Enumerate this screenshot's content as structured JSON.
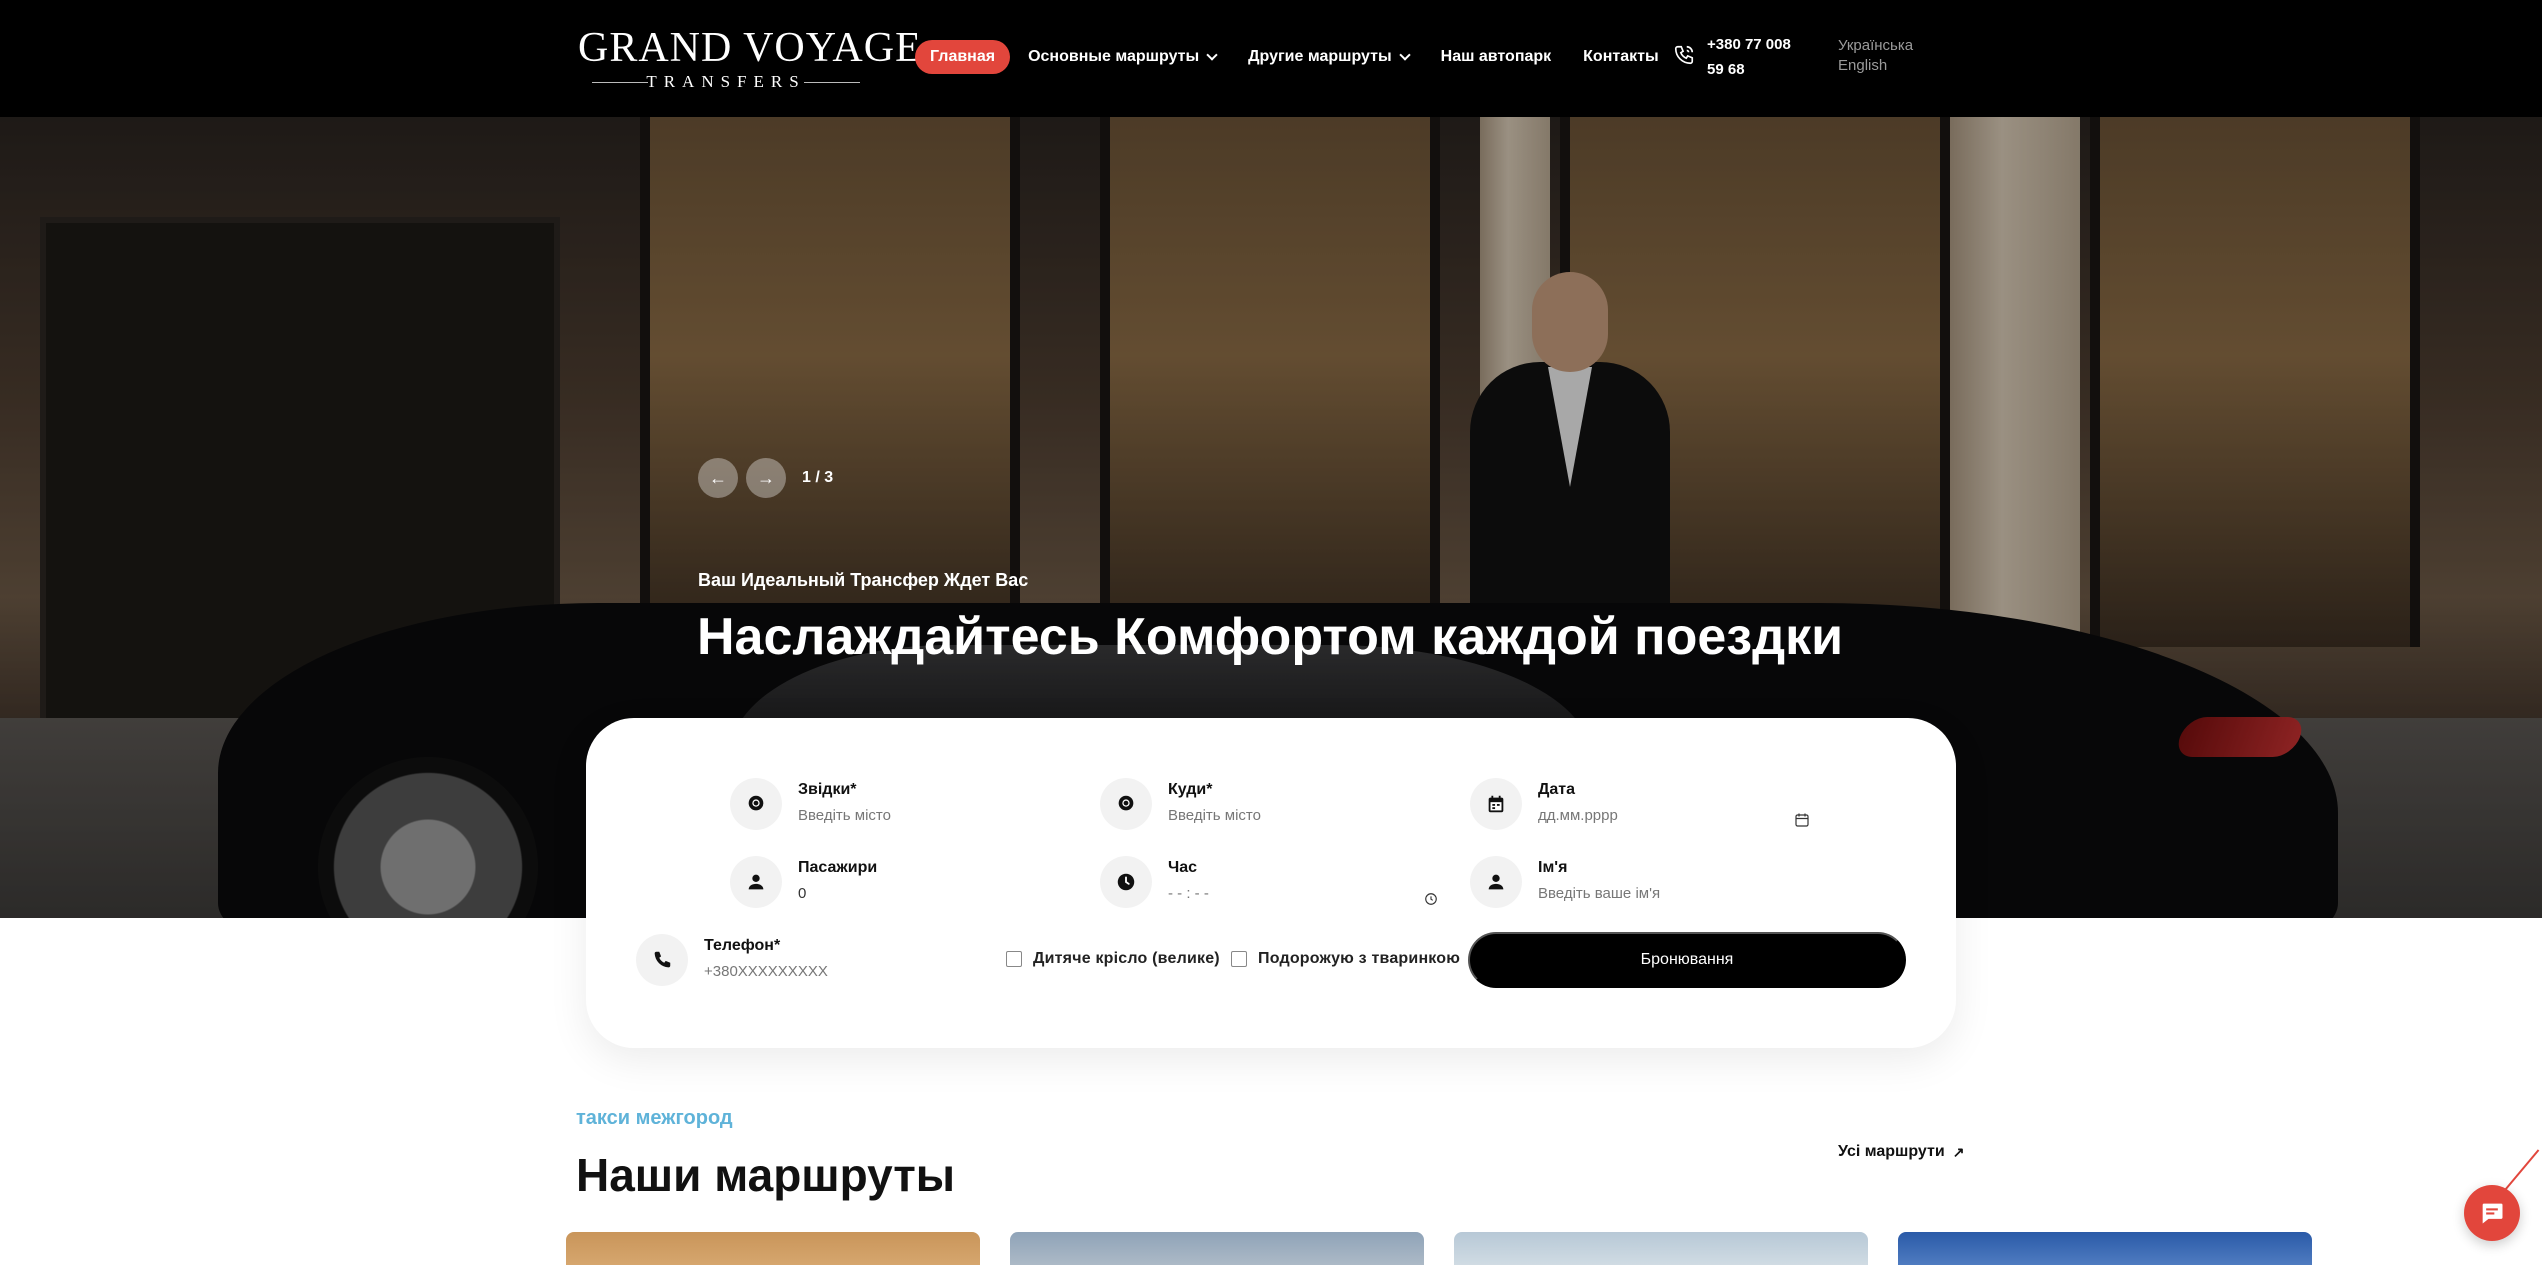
{
  "header": {
    "logo": {
      "main": "GRAND VOYAGE",
      "sub": "TRANSFERS"
    },
    "nav": [
      {
        "label": "Главная",
        "active": true
      },
      {
        "label": "Основные маршруты",
        "dropdown": true
      },
      {
        "label": "Другие маршруты",
        "dropdown": true
      },
      {
        "label": "Наш автопарк"
      },
      {
        "label": "Контакты"
      }
    ],
    "phone": "+380 77 008 59 68",
    "languages": [
      "Українська",
      "English"
    ]
  },
  "hero": {
    "slide_counter": "1 / 3",
    "eyebrow": "Ваш Идеальный Трансфер Ждет Вас",
    "title": "Наслаждайтесь Комфортом каждой поездки"
  },
  "booking_form": {
    "from": {
      "label": "Звідки*",
      "placeholder": "Введіть місто"
    },
    "to": {
      "label": "Куди*",
      "placeholder": "Введіть місто"
    },
    "date": {
      "label": "Дата",
      "placeholder": "дд.мм.рррр"
    },
    "passengers": {
      "label": "Пасажири",
      "value": "0"
    },
    "time": {
      "label": "Час",
      "placeholder": "- - : - -"
    },
    "name": {
      "label": "Ім'я",
      "placeholder": "Введіть ваше ім'я"
    },
    "phone": {
      "label": "Телефон*",
      "placeholder": "+380XXXXXXXXX"
    },
    "child_seat": {
      "label": "Дитяче крісло (велике)",
      "checked": false
    },
    "with_pet": {
      "label": "Подорожую з тваринкою",
      "checked": false
    },
    "submit_label": "Бронювання"
  },
  "routes_section": {
    "eyebrow": "такси межгород",
    "title": "Наши маршруты",
    "all_routes_label": "Усі маршрути"
  },
  "colors": {
    "accent": "#e2463c",
    "header_bg": "#000000",
    "eyebrow_blue": "#5fb3d9",
    "button_dark": "#000000"
  },
  "icons": [
    "phone-icon",
    "location-pin-icon",
    "calendar-icon",
    "person-icon",
    "clock-icon",
    "arrow-left-icon",
    "arrow-right-icon",
    "arrow-up-right-icon",
    "chat-icon"
  ]
}
